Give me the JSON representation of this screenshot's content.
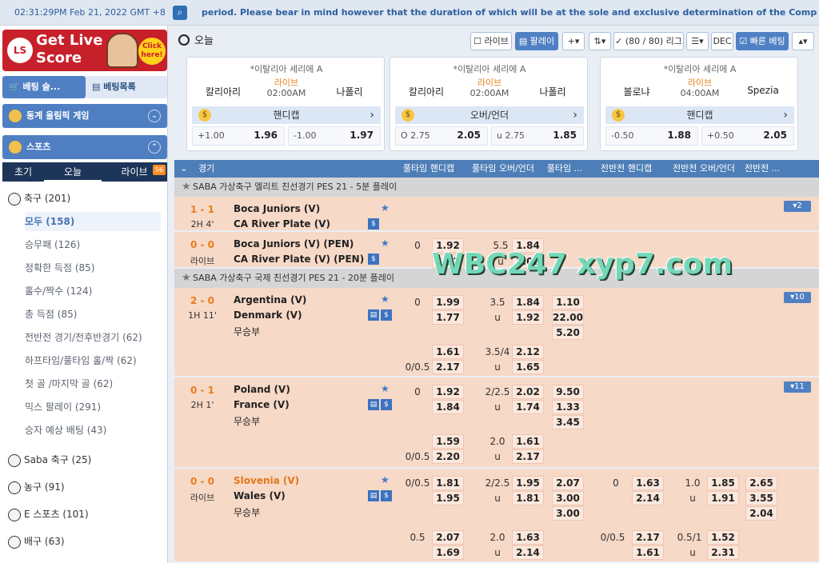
{
  "topbar": {
    "clock": "02:31:29PM Feb 21, 2022 GMT +8",
    "notice": "period. Please bear in mind however that the duration of which will be at the sole and exclusive determination of the Company. Thank You!"
  },
  "sidebar": {
    "banner_title": "Get Live Score",
    "banner_click": "Click here!",
    "bet_slip": "베팅 슬...",
    "bet_list": "베팅목록",
    "winter_games": "동계 올림픽 게임",
    "sports": "스포츠",
    "tabs": [
      "초기",
      "오늘",
      "라이브"
    ],
    "live_count": "56",
    "sports_list": [
      {
        "name": "축구",
        "count": "(201)"
      },
      {
        "name": "Saba 축구",
        "count": "(25)"
      },
      {
        "name": "농구",
        "count": "(91)"
      },
      {
        "name": "E 스포츠",
        "count": "(101)"
      },
      {
        "name": "배구",
        "count": "(63)"
      }
    ],
    "filters": [
      {
        "name": "모두",
        "count": "(158)"
      },
      {
        "name": "승무패",
        "count": "(126)"
      },
      {
        "name": "정확한 득점",
        "count": "(85)"
      },
      {
        "name": "홀수/짝수",
        "count": "(124)"
      },
      {
        "name": "총 득점",
        "count": "(85)"
      },
      {
        "name": "전반전 경기/전후반경기",
        "count": "(62)"
      },
      {
        "name": "하프타임/풀타임 홀/짝",
        "count": "(62)"
      },
      {
        "name": "첫 골 /마지막 골",
        "count": "(62)"
      },
      {
        "name": "믹스 팔레이",
        "count": "(291)"
      },
      {
        "name": "승자 예상 배팅",
        "count": "(43)"
      }
    ]
  },
  "main": {
    "crumb": "오늘",
    "toolbar": {
      "live": "라이브",
      "parlay": "팔레이",
      "plus": "+",
      "league_count": "(80 / 80) 리그",
      "odds_type": "DEC",
      "quick_bet": "빠른 베팅"
    },
    "cards": [
      {
        "league": "*이탈리아 세리에 A",
        "home": "칼리아리",
        "away": "나폴리",
        "status": "라이브",
        "time": "02:00AM",
        "market": "핸디캡",
        "odds": [
          {
            "label": "+1.00",
            "price": "1.96"
          },
          {
            "label": "-1.00",
            "price": "1.97"
          }
        ]
      },
      {
        "league": "*이탈리아 세리에 A",
        "home": "칼리아리",
        "away": "나폴리",
        "status": "라이브",
        "time": "02:00AM",
        "market": "오버/언더",
        "odds": [
          {
            "label": "O 2.75",
            "price": "2.05"
          },
          {
            "label": "u 2.75",
            "price": "1.85"
          }
        ]
      },
      {
        "league": "*이탈리아 세리에 A",
        "home": "볼로냐",
        "away": "Spezia",
        "status": "라이브",
        "time": "04:00AM",
        "market": "핸디캡",
        "odds": [
          {
            "label": "-0.50",
            "price": "1.88"
          },
          {
            "label": "+0.50",
            "price": "2.05"
          }
        ]
      }
    ],
    "table": {
      "headers": [
        "경기",
        "풀타임 핸디캡",
        "풀타임 오버/언더",
        "풀타임 ...",
        "전반전 핸디캡",
        "전반전 오버/언더",
        "전반전 ..."
      ],
      "leagues": [
        "SABA 가상축구 엘리트 친선경기 PES 21 - 5분 플레이",
        "SABA 가상축구 국제 친선경기 PES 21 - 20분 플레이"
      ],
      "matches": [
        {
          "score": "1 - 1",
          "period": "2H 4'",
          "home": "Boca Juniors (V)",
          "away": "CA River Plate (V)",
          "draw": "",
          "more": "▾2"
        },
        {
          "score": "0 - 0",
          "period": "라이브",
          "home": "Boca Juniors (V) (PEN)",
          "away": "CA River Plate (V) (PEN)",
          "draw": "",
          "hdp": [
            "0",
            "1.92",
            "",
            "1.92"
          ],
          "ou": [
            "5.5",
            "1.84",
            "u",
            "2.00"
          ]
        },
        {
          "score": "2 - 0",
          "period": "1H 11'",
          "home": "Argentina (V)",
          "away": "Denmark (V)",
          "draw": "무승부",
          "more": "▾10",
          "hdp": [
            "0",
            "1.99",
            "",
            "1.77",
            "",
            "1.61",
            "0/0.5",
            "2.17"
          ],
          "ou": [
            "3.5",
            "1.84",
            "u",
            "1.92",
            "3.5/4",
            "2.12",
            "u",
            "1.65"
          ],
          "x12": [
            "1.10",
            "22.00",
            "5.20"
          ]
        },
        {
          "score": "0 - 1",
          "period": "2H 1'",
          "home": "Poland (V)",
          "away": "France (V)",
          "draw": "무승부",
          "more": "▾11",
          "hdp": [
            "0",
            "1.92",
            "",
            "1.84",
            "",
            "1.59",
            "0/0.5",
            "2.20"
          ],
          "ou": [
            "2/2.5",
            "2.02",
            "u",
            "1.74",
            "2.0",
            "1.61",
            "u",
            "2.17"
          ],
          "x12": [
            "9.50",
            "1.33",
            "3.45"
          ]
        },
        {
          "score": "0 - 0",
          "period": "라이브",
          "home": "Slovenia (V)",
          "away": "Wales (V)",
          "draw": "무승부",
          "hdp": [
            "0/0.5",
            "1.81",
            "",
            "1.95",
            "0.5",
            "2.07",
            "",
            "1.69"
          ],
          "ou": [
            "2/2.5",
            "1.95",
            "u",
            "1.81",
            "2.0",
            "1.63",
            "u",
            "2.14"
          ],
          "x12": [
            "2.07",
            "3.00",
            "3.00"
          ],
          "h1hdp": [
            "0",
            "1.63",
            "",
            "2.14",
            "0/0.5",
            "2.17",
            "",
            "1.61"
          ],
          "h1ou": [
            "1.0",
            "1.85",
            "u",
            "1.91",
            "0.5/1",
            "1.52",
            "u",
            "2.31"
          ],
          "h1x12": [
            "2.65",
            "3.55",
            "2.04"
          ]
        }
      ]
    },
    "watermark": "WBC247  xyp7.com"
  }
}
